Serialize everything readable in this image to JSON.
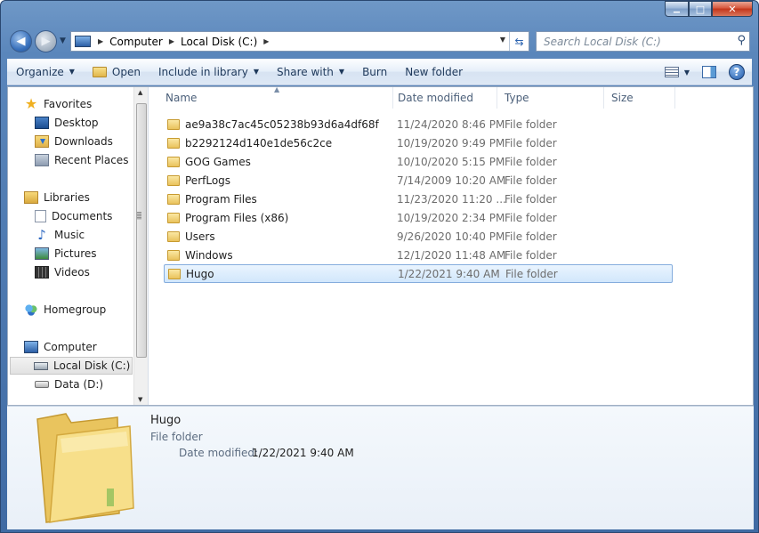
{
  "window": {
    "minimize_glyph": "▁",
    "maximize_glyph": "□",
    "close_glyph": "✕"
  },
  "address": {
    "segments": [
      "Computer",
      "Local Disk (C:)"
    ],
    "refresh_icon": "refresh-icon"
  },
  "search": {
    "placeholder": "Search Local Disk (C:)",
    "icon": "search-icon"
  },
  "toolbar": {
    "organize": "Organize",
    "open": "Open",
    "include_in_library": "Include in library",
    "share_with": "Share with",
    "burn": "Burn",
    "new_folder": "New folder",
    "help": "?"
  },
  "nav": {
    "favorites": "Favorites",
    "desktop": "Desktop",
    "downloads": "Downloads",
    "recent_places": "Recent Places",
    "libraries": "Libraries",
    "documents": "Documents",
    "music": "Music",
    "pictures": "Pictures",
    "videos": "Videos",
    "homegroup": "Homegroup",
    "computer": "Computer",
    "local_disk": "Local Disk (C:)",
    "data_disk": "Data (D:)"
  },
  "columns": {
    "name": "Name",
    "date_modified": "Date modified",
    "type": "Type",
    "size": "Size"
  },
  "files": [
    {
      "name": "ae9a38c7ac45c05238b93d6a4df68f",
      "date": "11/24/2020 8:46 PM",
      "type": "File folder"
    },
    {
      "name": "b2292124d140e1de56c2ce",
      "date": "10/19/2020 9:49 PM",
      "type": "File folder"
    },
    {
      "name": "GOG Games",
      "date": "10/10/2020 5:15 PM",
      "type": "File folder"
    },
    {
      "name": "PerfLogs",
      "date": "7/14/2009 10:20 AM",
      "type": "File folder"
    },
    {
      "name": "Program Files",
      "date": "11/23/2020 11:20 ...",
      "type": "File folder"
    },
    {
      "name": "Program Files (x86)",
      "date": "10/19/2020 2:34 PM",
      "type": "File folder"
    },
    {
      "name": "Users",
      "date": "9/26/2020 10:40 PM",
      "type": "File folder"
    },
    {
      "name": "Windows",
      "date": "12/1/2020 11:48 AM",
      "type": "File folder"
    },
    {
      "name": "Hugo",
      "date": "1/22/2021 9:40 AM",
      "type": "File folder",
      "selected": true
    }
  ],
  "details": {
    "name": "Hugo",
    "type": "File folder",
    "date_label": "Date modified:",
    "date_value": "1/22/2021 9:40 AM"
  }
}
